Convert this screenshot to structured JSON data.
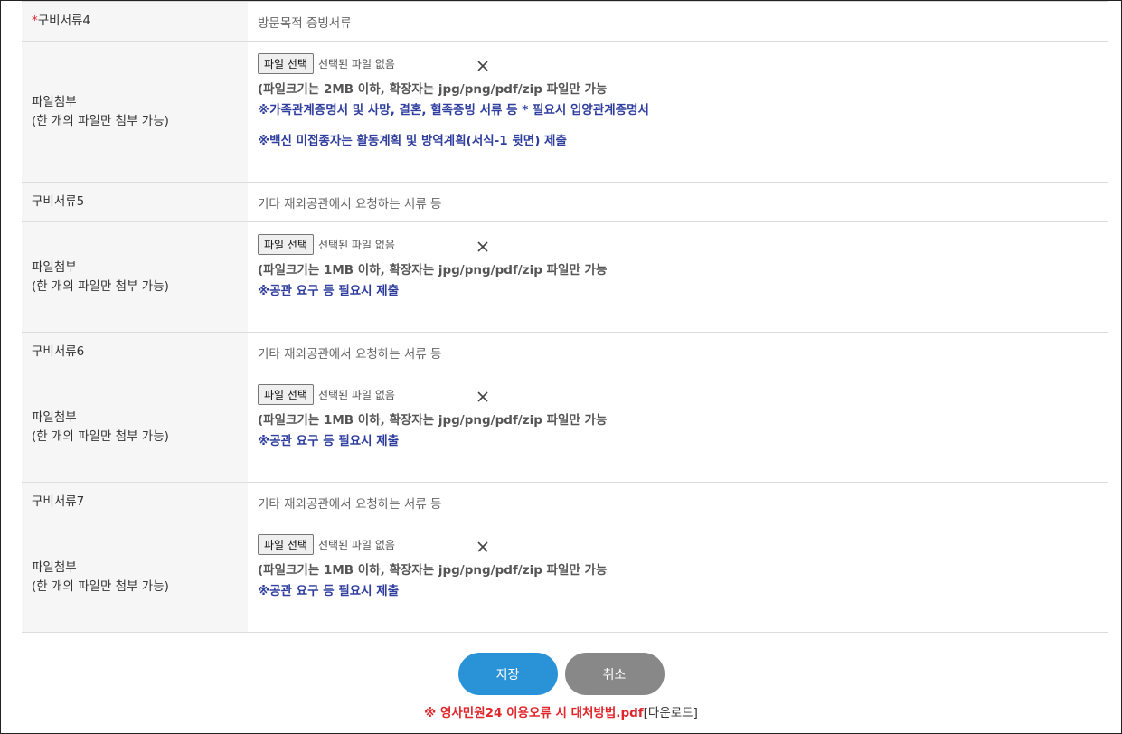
{
  "sections": [
    {
      "doc_label": "구비서류4",
      "required_mark": "*",
      "doc_desc": "방문목적 증빙서류",
      "upload_label_1": "파일첨부",
      "upload_label_2": "(한 개의 파일만 첨부 가능)",
      "file_button": "파일 선택",
      "file_status": "선택된 파일 없음",
      "note_size": "(파일크기는 2MB 이하, 확장자는 jpg/png/pdf/zip 파일만 가능",
      "note_req_1": "※가족관계증명서 및 사망, 결혼, 혈족증빙 서류 등 * 필요시 입양관계증명서",
      "note_req_2": "※백신 미접종자는 활동계획 및 방역계획(서식-1 뒷면) 제출"
    },
    {
      "doc_label": "구비서류5",
      "doc_desc": "기타 재외공관에서 요청하는 서류 등",
      "upload_label_1": "파일첨부",
      "upload_label_2": "(한 개의 파일만 첨부 가능)",
      "file_button": "파일 선택",
      "file_status": "선택된 파일 없음",
      "note_size": "(파일크기는 1MB 이하, 확장자는 jpg/png/pdf/zip 파일만 가능",
      "note_req_1": "※공관 요구 등 필요시 제출"
    },
    {
      "doc_label": "구비서류6",
      "doc_desc": "기타 재외공관에서 요청하는 서류 등",
      "upload_label_1": "파일첨부",
      "upload_label_2": "(한 개의 파일만 첨부 가능)",
      "file_button": "파일 선택",
      "file_status": "선택된 파일 없음",
      "note_size": "(파일크기는 1MB 이하, 확장자는 jpg/png/pdf/zip 파일만 가능",
      "note_req_1": "※공관 요구 등 필요시 제출"
    },
    {
      "doc_label": "구비서류7",
      "doc_desc": "기타 재외공관에서 요청하는 서류 등",
      "upload_label_1": "파일첨부",
      "upload_label_2": "(한 개의 파일만 첨부 가능)",
      "file_button": "파일 선택",
      "file_status": "선택된 파일 없음",
      "note_size": "(파일크기는 1MB 이하, 확장자는 jpg/png/pdf/zip 파일만 가능",
      "note_req_1": "※공관 요구 등 필요시 제출"
    }
  ],
  "icons": {
    "clear": "close-icon"
  },
  "actions": {
    "save_label": "저장",
    "cancel_label": "취소"
  },
  "footer": {
    "notice": "※ 영사민원24 이용오류 시 대처방법.pdf",
    "download_label": "[다운로드]"
  },
  "colors": {
    "required": "#e0262b",
    "note_blue": "#2f3e9e",
    "save_button": "#2a93d8",
    "cancel_button": "#888888"
  }
}
